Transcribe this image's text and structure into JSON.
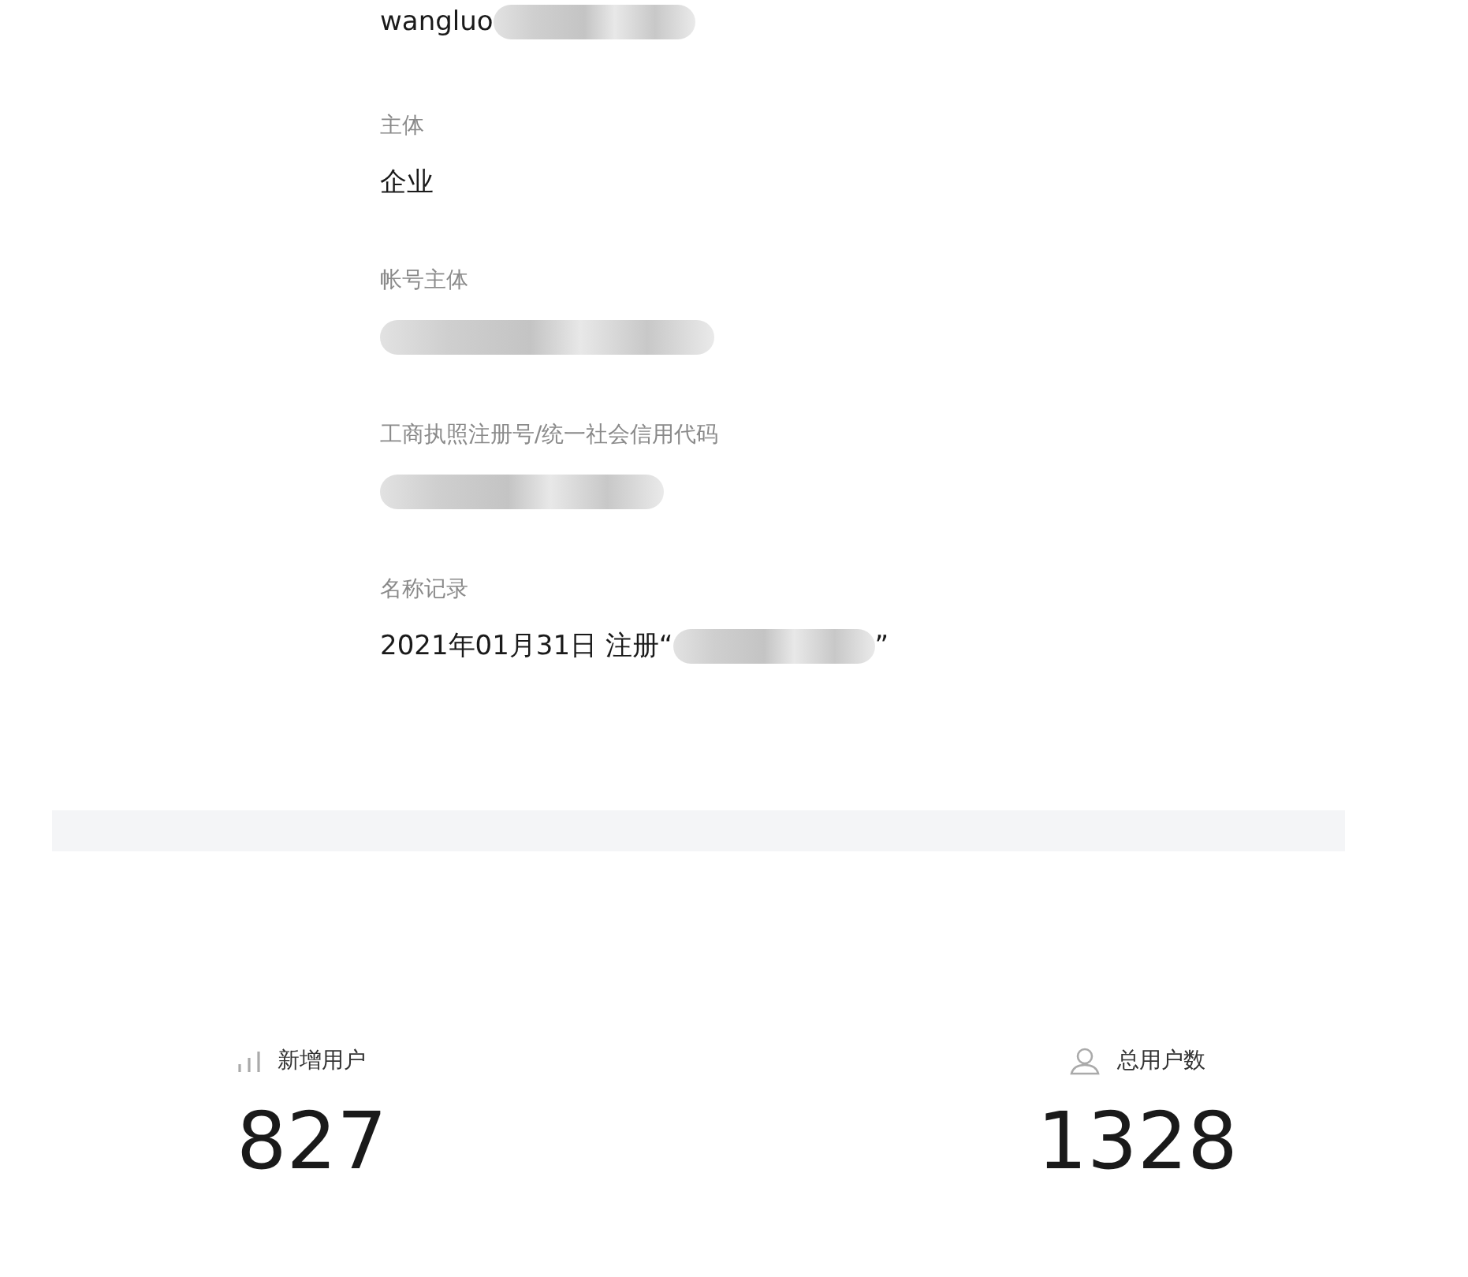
{
  "fields": [
    {
      "value_parts": [
        {
          "kind": "text",
          "text": "wangluo"
        },
        {
          "kind": "blurred"
        }
      ]
    },
    {
      "label": "主体",
      "value_parts": [
        {
          "kind": "text",
          "text": "企业"
        }
      ]
    },
    {
      "label": "帐号主体",
      "value_parts": [
        {
          "kind": "blurred"
        }
      ]
    },
    {
      "label": "工商执照注册号/统一社会信用代码",
      "value_parts": [
        {
          "kind": "blurred"
        }
      ]
    },
    {
      "label": "名称记录",
      "value_parts": [
        {
          "kind": "text",
          "text": "2021年01月31日 注册“"
        },
        {
          "kind": "blurred"
        },
        {
          "kind": "text",
          "text": "”"
        }
      ]
    }
  ],
  "stats": [
    {
      "kind": "bars",
      "label": "新增用户",
      "value": "827"
    },
    {
      "kind": "person",
      "label": "总用户数",
      "value": "1328"
    }
  ]
}
